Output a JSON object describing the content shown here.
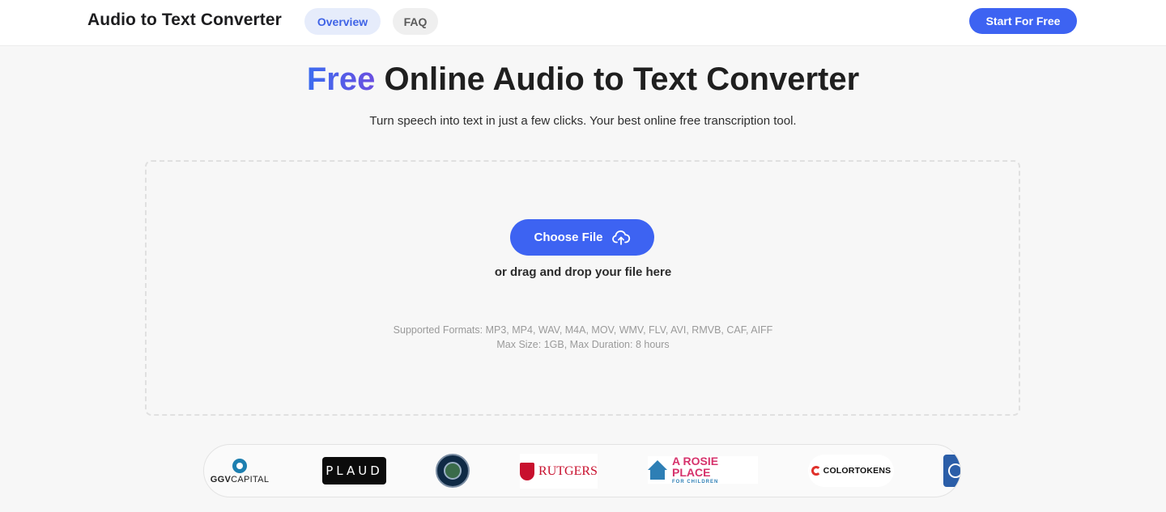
{
  "header": {
    "brand": "Audio to Text Converter",
    "nav": [
      {
        "label": "Overview",
        "active": true
      },
      {
        "label": "FAQ",
        "active": false
      }
    ],
    "cta_label": "Start For Free"
  },
  "hero": {
    "title_accent": "Free",
    "title_rest": " Online Audio to Text Converter",
    "subtitle": "Turn speech into text in just a few clicks. Your best online free transcription tool."
  },
  "upload": {
    "button_label": "Choose File",
    "button_icon": "cloud-upload-icon",
    "drag_text": "or drag and drop your file here",
    "formats": "Supported Formats: MP3, MP4, WAV, M4A, MOV, WMV, FLV, AVI, RMVB, CAF, AIFF",
    "limits": "Max Size: 1GB, Max Duration: 8 hours"
  },
  "logos": {
    "ggv_bold": "GGV",
    "ggv_rest": "CAPITAL",
    "plaud": "PLAUD",
    "rutgers": "RUTGERS",
    "rosie_main": "A ROSIE PLACE",
    "rosie_sub": "FOR CHILDREN",
    "colortokens": "COLORTOKENS"
  },
  "colors": {
    "accent": "#3d63f2",
    "nav_active_bg": "#e6ecfb",
    "page_bg": "#f7f7f7"
  }
}
